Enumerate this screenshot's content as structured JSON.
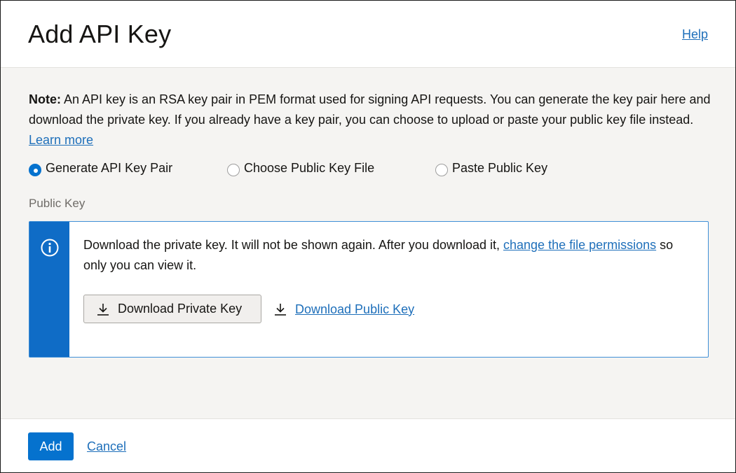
{
  "header": {
    "title": "Add API Key",
    "help_label": "Help"
  },
  "note": {
    "label": "Note:",
    "text": " An API key is an RSA key pair in PEM format used for signing API requests. You can generate the key pair here and download the private key. If you already have a key pair, you can choose to upload or paste your public key file instead. ",
    "learn_more": "Learn more"
  },
  "options": [
    {
      "label": "Generate API Key Pair",
      "checked": true
    },
    {
      "label": "Choose Public Key File",
      "checked": false
    },
    {
      "label": "Paste Public Key",
      "checked": false
    }
  ],
  "public_key_section": {
    "label": "Public Key",
    "info_text_before": "Download the private key. It will not be shown again. After you download it, ",
    "info_link": "change the file permissions",
    "info_text_after": " so only you can view it.",
    "download_private_label": "Download Private Key",
    "download_public_label": "Download Public Key"
  },
  "footer": {
    "add_label": "Add",
    "cancel_label": "Cancel"
  },
  "colors": {
    "accent": "#0572ce",
    "link": "#1e6fba",
    "info_stripe": "#0f6cc6"
  },
  "icons": {
    "info": "info-circle-icon",
    "download": "download-arrow-icon"
  }
}
